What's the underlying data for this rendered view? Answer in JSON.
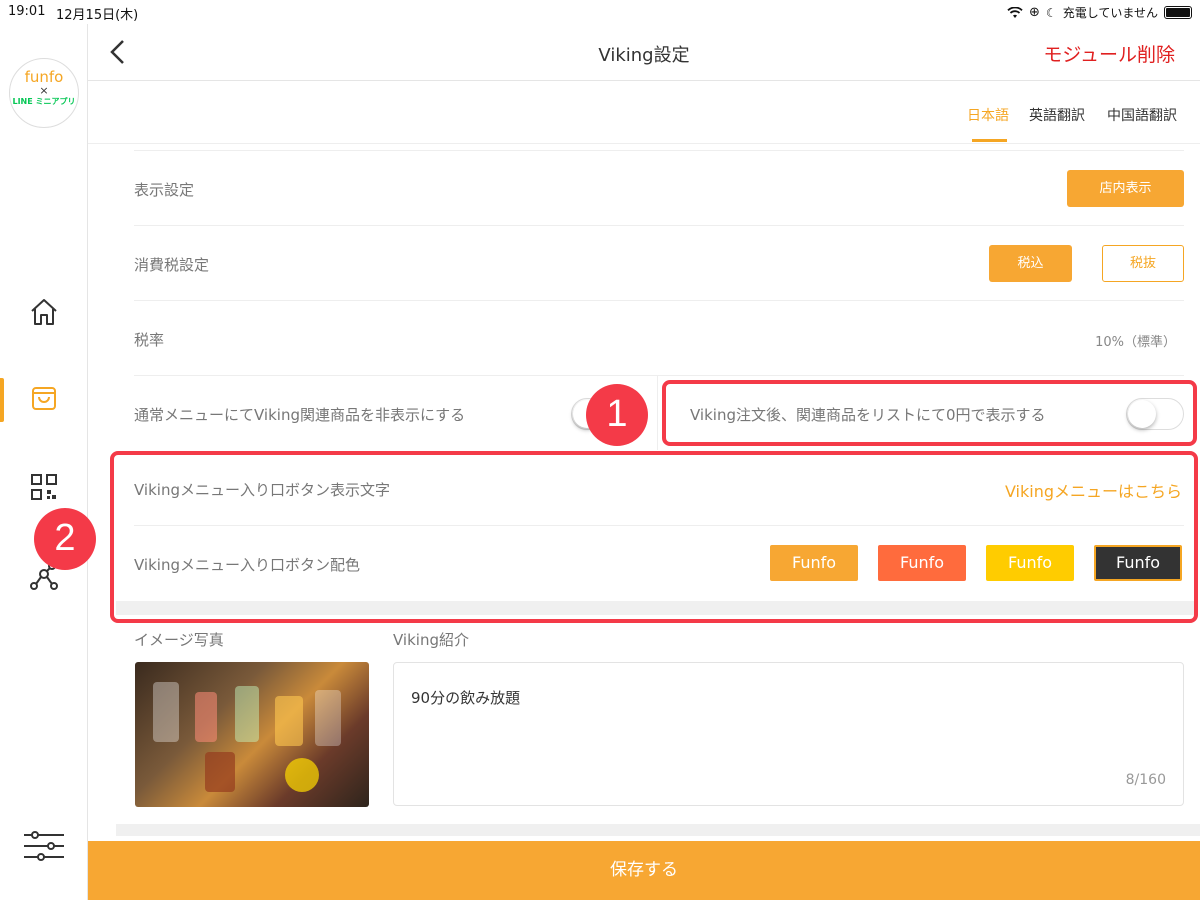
{
  "status_bar": {
    "time": "19:01",
    "date": "12月15日(木)",
    "charging": "充電していません"
  },
  "sidebar": {
    "logo": {
      "line1": "funfo",
      "line2": "×",
      "line3": "LINE ミニアプリ"
    },
    "items": [
      {
        "icon": "home-icon"
      },
      {
        "icon": "shopping-bag-icon",
        "active": true
      },
      {
        "icon": "qr-code-icon"
      },
      {
        "icon": "network-icon"
      },
      {
        "icon": "settings-sliders-icon"
      }
    ]
  },
  "header": {
    "back": "‹",
    "title": "Viking設定",
    "delete_label": "モジュール削除"
  },
  "tabs": [
    {
      "label": "日本語",
      "active": true
    },
    {
      "label": "英語翻訳"
    },
    {
      "label": "中国語翻訳"
    }
  ],
  "settings": {
    "display": {
      "label": "表示設定",
      "button": "店内表示"
    },
    "tax": {
      "label": "消費税設定",
      "included": "税込",
      "excluded": "税抜"
    },
    "tax_rate": {
      "label": "税率",
      "value": "10%（標準）"
    },
    "hide_related": {
      "label": "通常メニューにてViking関連商品を非表示にする"
    },
    "show_zero": {
      "label": "Viking注文後、関連商品をリストにて0円で表示する"
    },
    "entry_text": {
      "label": "Vikingメニュー入り口ボタン表示文字",
      "value": "Vikingメニューはこちら"
    },
    "entry_color": {
      "label": "Vikingメニュー入り口ボタン配色",
      "options": [
        {
          "label": "Funfo",
          "color": "#f7a733"
        },
        {
          "label": "Funfo",
          "color": "#ff6b3d"
        },
        {
          "label": "Funfo",
          "color": "#ffcc00"
        },
        {
          "label": "Funfo",
          "color": "#333333",
          "selected": true
        }
      ]
    }
  },
  "callouts": {
    "one": "1",
    "two": "2"
  },
  "image_section": {
    "label": "イメージ写真"
  },
  "intro": {
    "label": "Viking紹介",
    "text": "90分の飲み放題",
    "counter": "8/160"
  },
  "save_label": "保存する",
  "colors": {
    "accent": "#f7a733",
    "danger": "#e02020",
    "callout": "#f43a48"
  }
}
